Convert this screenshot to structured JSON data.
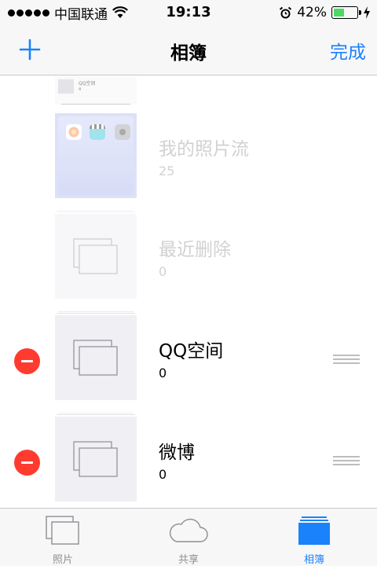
{
  "status_bar": {
    "carrier": "中国联通",
    "time": "19:13",
    "battery_percent": "42%",
    "battery_level": 0.42
  },
  "nav_bar": {
    "add_label": "+",
    "title": "相簿",
    "done_label": "完成"
  },
  "albums": [
    {
      "name": "QQ空间",
      "count": "4",
      "state": "partially-visible"
    },
    {
      "name": "我的照片流",
      "count": "25",
      "state": "dimmed"
    },
    {
      "name": "最近删除",
      "count": "0",
      "state": "dimmed"
    },
    {
      "name": "QQ空间",
      "count": "0",
      "state": "editable"
    },
    {
      "name": "微博",
      "count": "0",
      "state": "editable"
    }
  ],
  "tab_bar": {
    "tabs": [
      {
        "label": "照片",
        "icon": "photos-icon",
        "active": false
      },
      {
        "label": "共享",
        "icon": "cloud-icon",
        "active": false
      },
      {
        "label": "相簿",
        "icon": "albums-icon",
        "active": true
      }
    ]
  },
  "colors": {
    "accent": "#1a82fb",
    "delete": "#ff3b30",
    "battery": "#4cd964"
  }
}
